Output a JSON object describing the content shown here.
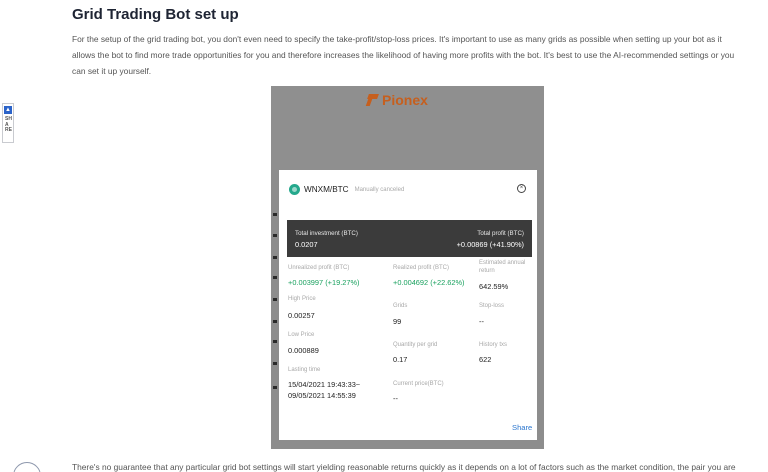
{
  "article": {
    "title": "Grid Trading Bot set up",
    "paragraph_1": "For the setup of the grid trading bot, you don't even need to specify the take-profit/stop-loss prices. It's important to use as many grids as possible when setting up your bot as it allows the bot to find more trade opportunities for you and therefore increases the likelihood of having more profits with the bot. It's best to use the AI-recommended settings or you can set it up yourself.",
    "paragraph_2": "There's no guarantee that any particular grid bot settings will start yielding reasonable returns quickly as it depends on a lot of factors such as the market condition, the pair you are"
  },
  "share_tab": {
    "label": "SHARE",
    "icon": "share-logo-icon"
  },
  "screenshot": {
    "brand": "Pionex",
    "brand_color": "#c65f1e",
    "dialog": {
      "pair": "WNXM/BTC",
      "status": "Manually canceled",
      "close_icon": "close-circle-icon",
      "total_investment_label": "Total investment (BTC)",
      "total_investment_value": "0.0207",
      "total_profit_label": "Total profit (BTC)",
      "total_profit_value": "+0.00869 (+41.90%)",
      "unrealized_label": "Unrealized profit (BTC)",
      "unrealized_value": "+0.003997 (+19.27%)",
      "realized_label": "Realized profit (BTC)",
      "realized_value": "+0.004692 (+22.62%)",
      "annual_label": "Estimated annual return",
      "annual_value": "642.59%",
      "high_label": "High Price",
      "high_value": "0.00257",
      "grids_label": "Grids",
      "grids_value": "99",
      "stoploss_label": "Stop-loss",
      "stoploss_value": "--",
      "low_label": "Low Price",
      "low_value": "0.000889",
      "qty_label": "Quantity per grid",
      "qty_value": "0.17",
      "history_label": "History txs",
      "history_value": "622",
      "lasting_label": "Lasting time",
      "lasting_value_1": "15/04/2021 19:43:33~",
      "lasting_value_2": "09/05/2021 14:55:39",
      "current_price_label": "Current price(BTC)",
      "current_price_value": "--",
      "share_label": "Share",
      "green": "#1aa15f",
      "link_color": "#2d77cf"
    }
  }
}
